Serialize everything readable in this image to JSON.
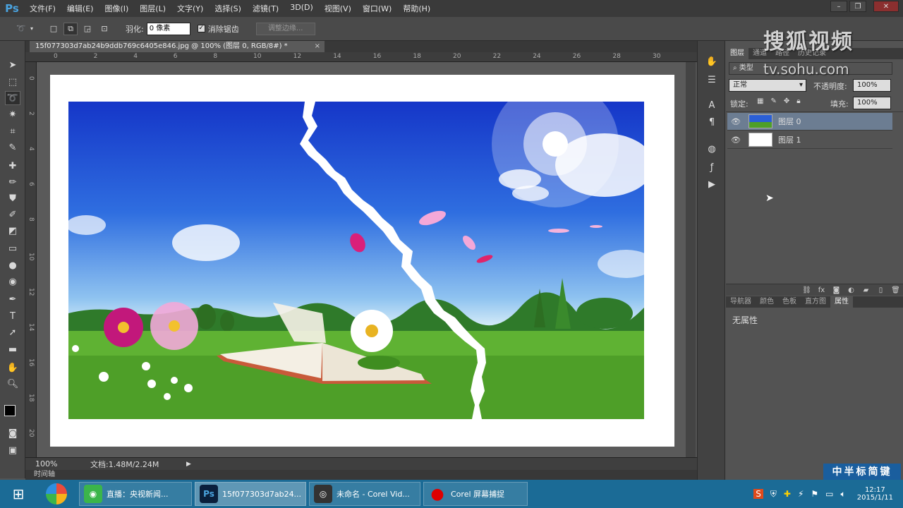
{
  "app": {
    "logo": "Ps"
  },
  "menu": [
    "文件(F)",
    "编辑(E)",
    "图像(I)",
    "图层(L)",
    "文字(Y)",
    "选择(S)",
    "滤镜(T)",
    "3D(D)",
    "视图(V)",
    "窗口(W)",
    "帮助(H)"
  ],
  "options": {
    "feather_label": "羽化:",
    "feather_value": "0 像素",
    "antialias_label": "消除锯齿",
    "antialias_checked": true,
    "refine_label": "调整边缘..."
  },
  "document": {
    "tab_title": "15f077303d7ab24b9ddb769c6405e846.jpg @ 100% (图层 0, RGB/8#) *",
    "zoom": "100%",
    "doc_info": "文档:1.48M/2.24M",
    "timeline_label": "时间轴"
  },
  "ruler": {
    "top": [
      "0",
      "2",
      "4",
      "6",
      "8",
      "10",
      "12",
      "14",
      "16",
      "18",
      "20",
      "22",
      "24",
      "26",
      "28",
      "30"
    ],
    "left": [
      "0",
      "2",
      "4",
      "6",
      "8",
      "10",
      "12",
      "14",
      "16",
      "18",
      "20"
    ]
  },
  "layers_panel": {
    "tabs": [
      "图层",
      "通道",
      "路径",
      "历史记录"
    ],
    "filter": "类型",
    "blend_mode": "正常",
    "opacity_label": "不透明度:",
    "opacity_value": "100%",
    "lock_label": "锁定:",
    "fill_label": "填充:",
    "fill_value": "100%",
    "layers": [
      {
        "name": "图层 0",
        "selected": true
      },
      {
        "name": "图层 1",
        "selected": false
      }
    ]
  },
  "props_panel": {
    "tabs": [
      "导航器",
      "颜色",
      "色板",
      "直方图",
      "属性"
    ],
    "empty_text": "无属性"
  },
  "watermark": {
    "brand": "搜狐视频",
    "url": "tv.sohu.com"
  },
  "ime": "中半标简键",
  "taskbar": {
    "items": [
      {
        "label": "直播：央视新闻...",
        "icon": "live-icon",
        "color": "#3bb54a"
      },
      {
        "label": "15f077303d7ab24...",
        "icon": "photoshop-icon",
        "color": "#0a1f3c"
      },
      {
        "label": "未命名 - Corel Vid...",
        "icon": "corel-video-icon",
        "color": "#333"
      },
      {
        "label": "Corel 屏幕捕捉",
        "icon": "record-icon",
        "color": "#c00"
      }
    ],
    "time": "12:17",
    "date": "2015/1/11"
  },
  "colors": {
    "accent": "#4aa3df",
    "selected_layer": "#6c7d92",
    "taskbar": "#1b6b96"
  }
}
